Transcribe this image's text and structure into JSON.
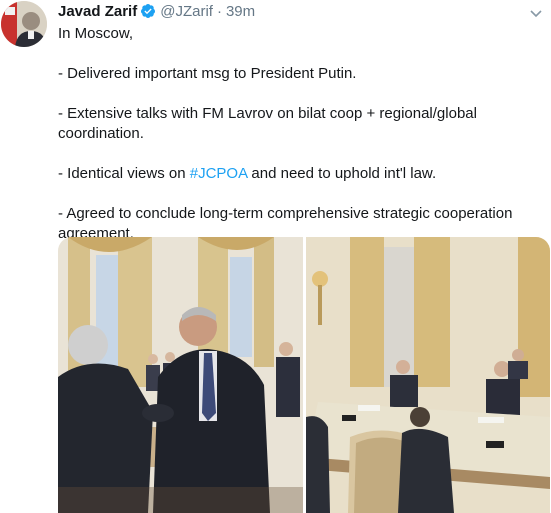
{
  "tweet": {
    "author_name": "Javad Zarif",
    "handle": "@JZarif",
    "separator": "·",
    "time": "39m",
    "verified_icon": "verified-badge-icon",
    "menu_icon": "chevron-down-icon",
    "text": {
      "line1": "In Moscow,",
      "bullet1": "- Delivered important msg to President Putin.",
      "bullet2": "- Extensive talks with FM Lavrov on bilat coop + regional/global coordination.",
      "bullet3_pre": "- Identical views on ",
      "bullet3_tag": "#JCPOA",
      "bullet3_post": " and need to uphold int'l law.",
      "bullet4": "- Agreed to conclude long-term comprehensive strategic cooperation agreement."
    },
    "colors": {
      "link": "#1da1f2",
      "secondary": "#657786",
      "text": "#14171a"
    }
  }
}
